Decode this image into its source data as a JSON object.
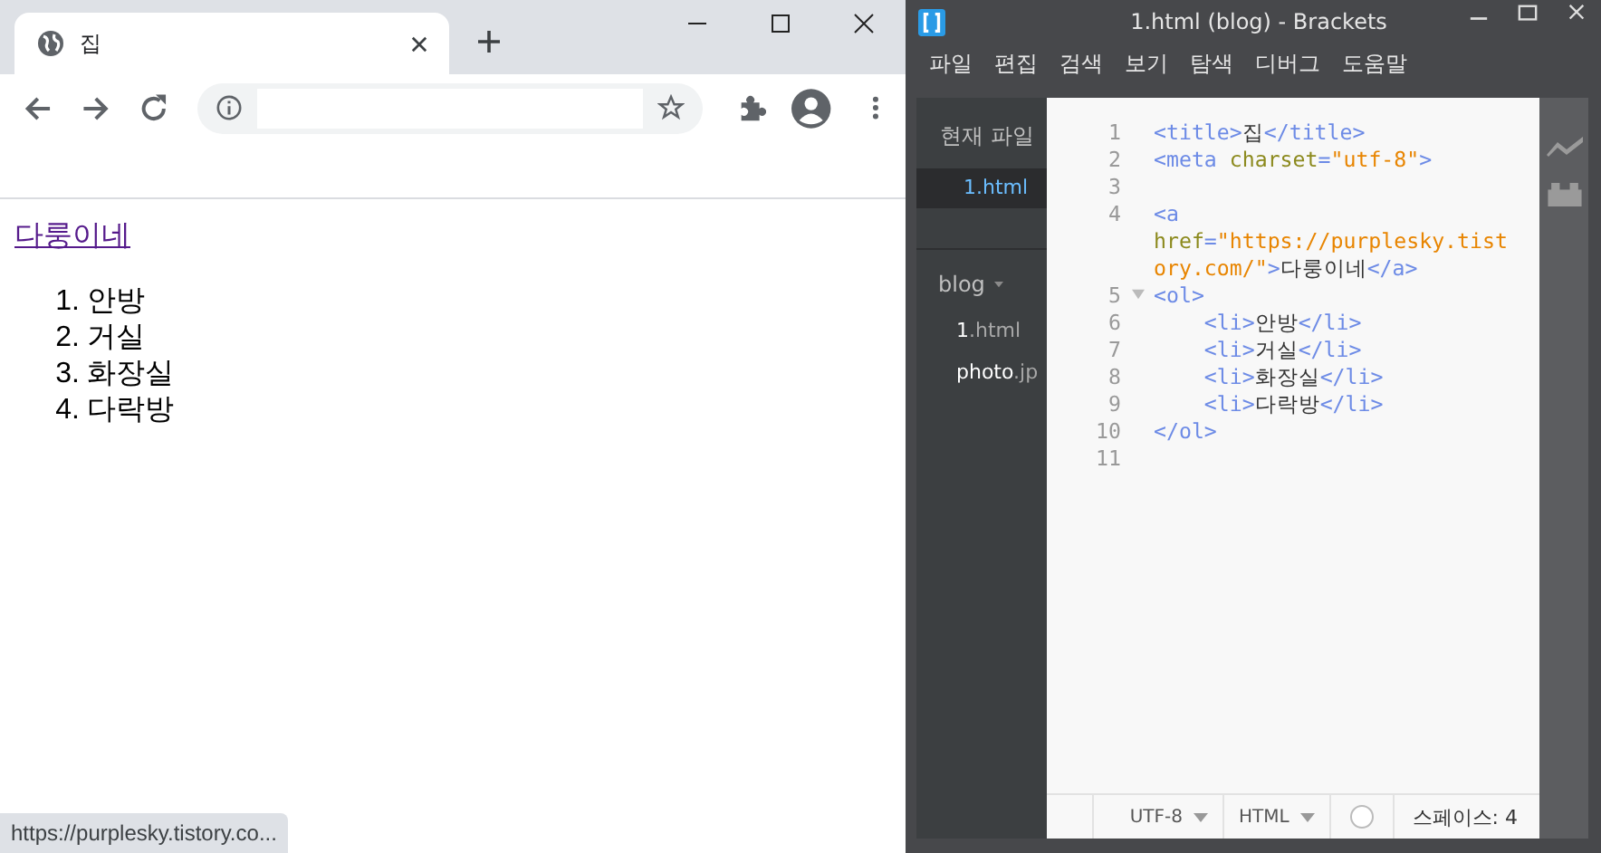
{
  "browser": {
    "tab": {
      "title": "집"
    },
    "page": {
      "link": "다룽이네",
      "list": [
        {
          "marker": "1.",
          "text": "안방"
        },
        {
          "marker": "2.",
          "text": "거실"
        },
        {
          "marker": "3.",
          "text": "화장실"
        },
        {
          "marker": "4.",
          "text": "다락방"
        }
      ]
    },
    "status_url": "https://purplesky.tistory.co..."
  },
  "editor": {
    "title": "1.html (blog) - Brackets",
    "menu": [
      "파일",
      "편집",
      "검색",
      "보기",
      "탐색",
      "디버그",
      "도움말"
    ],
    "working_label": "현재 파일",
    "working_files": [
      {
        "name": "1.html",
        "selected": true
      }
    ],
    "project": "blog",
    "project_files": [
      {
        "name": "1",
        "ext": ".html"
      },
      {
        "name": "photo",
        "ext": ".jp"
      }
    ],
    "lines": [
      {
        "n": "1",
        "tokens": [
          {
            "kind": "tag",
            "t": "<title>"
          },
          {
            "kind": "text",
            "t": "집"
          },
          {
            "kind": "tag",
            "t": "</title>"
          }
        ]
      },
      {
        "n": "2",
        "tokens": [
          {
            "kind": "tag",
            "t": "<meta "
          },
          {
            "kind": "attr",
            "t": "charset"
          },
          {
            "kind": "tag",
            "t": "="
          },
          {
            "kind": "str",
            "t": "\"utf-8\""
          },
          {
            "kind": "tag",
            "t": ">"
          }
        ]
      },
      {
        "n": "3"
      },
      {
        "n": "4",
        "tokens": [
          {
            "kind": "tag",
            "t": "<a "
          },
          {
            "kind": "attr",
            "t": "href"
          },
          {
            "kind": "tag",
            "t": "="
          },
          {
            "kind": "str",
            "t": "\"https://purplesky.tistory.com/\""
          },
          {
            "kind": "tag",
            "t": ">"
          },
          {
            "kind": "text",
            "t": "다룽이네"
          },
          {
            "kind": "tag",
            "t": "</a>"
          }
        ]
      },
      {
        "n": "5",
        "fold": true,
        "tokens": [
          {
            "kind": "tag",
            "t": "<ol>"
          }
        ]
      },
      {
        "n": "6",
        "indent": true,
        "tokens": [
          {
            "kind": "tag",
            "t": "<li>"
          },
          {
            "kind": "text",
            "t": "안방"
          },
          {
            "kind": "tag",
            "t": "</li>"
          }
        ]
      },
      {
        "n": "7",
        "indent": true,
        "tokens": [
          {
            "kind": "tag",
            "t": "<li>"
          },
          {
            "kind": "text",
            "t": "거실"
          },
          {
            "kind": "tag",
            "t": "</li>"
          }
        ]
      },
      {
        "n": "8",
        "indent": true,
        "tokens": [
          {
            "kind": "tag",
            "t": "<li>"
          },
          {
            "kind": "text",
            "t": "화장실"
          },
          {
            "kind": "tag",
            "t": "</li>"
          }
        ]
      },
      {
        "n": "9",
        "indent": true,
        "tokens": [
          {
            "kind": "tag",
            "t": "<li>"
          },
          {
            "kind": "text",
            "t": "다락방"
          },
          {
            "kind": "tag",
            "t": "</li>"
          }
        ]
      },
      {
        "n": "10",
        "tokens": [
          {
            "kind": "tag",
            "t": "</ol>"
          }
        ]
      },
      {
        "n": "11"
      }
    ],
    "status": {
      "encoding": "UTF-8",
      "language": "HTML",
      "indent": "스페이스: 4"
    }
  }
}
